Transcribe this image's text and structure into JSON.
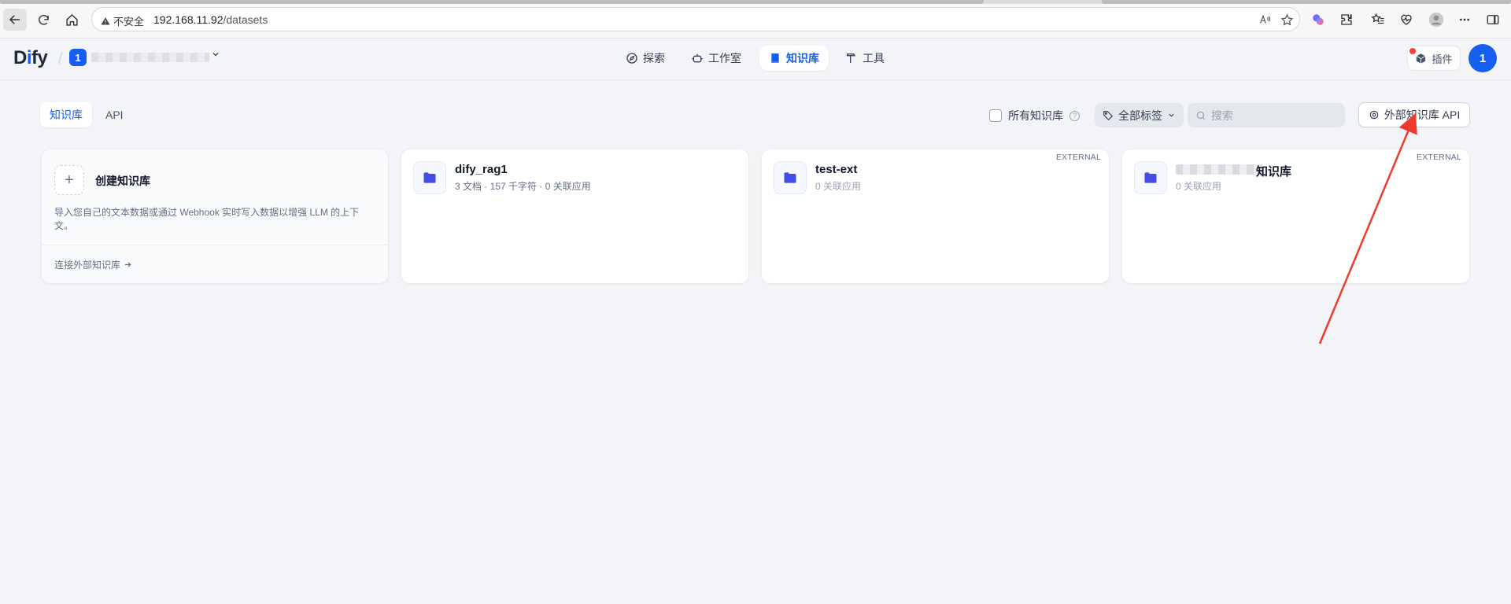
{
  "browser": {
    "security_label": "不安全",
    "url_host": "192.168.11.92",
    "url_path": "/datasets"
  },
  "header": {
    "logo": "Dify",
    "workspace_initial": "1",
    "nav": [
      {
        "label": "探索",
        "icon": "compass-icon"
      },
      {
        "label": "工作室",
        "icon": "robot-icon"
      },
      {
        "label": "知识库",
        "icon": "book-icon",
        "active": true
      },
      {
        "label": "工具",
        "icon": "hammer-icon"
      }
    ],
    "plugins_label": "插件",
    "avatar_initial": "1"
  },
  "toolbar": {
    "tabs": [
      "知识库",
      "API"
    ],
    "all_kb_label": "所有知识库",
    "tags_label": "全部标签",
    "search_placeholder": "搜索",
    "external_api_label": "外部知识库 API"
  },
  "create_card": {
    "title": "创建知识库",
    "description": "导入您自己的文本数据或通过 Webhook 实时写入数据以增强 LLM 的上下文。",
    "connect_label": "连接外部知识库"
  },
  "datasets": [
    {
      "name": "dify_rag1",
      "meta": "3 文档 · 157 千字符 · 0 关联应用",
      "external": false
    },
    {
      "name": "test-ext",
      "meta": "0 关联应用",
      "external": true,
      "badge": "EXTERNAL"
    },
    {
      "name": "知识库",
      "meta": "0 关联应用",
      "external": true,
      "badge": "EXTERNAL"
    }
  ],
  "colors": {
    "accent": "#155eef",
    "annotation_arrow": "#f03a2e"
  }
}
